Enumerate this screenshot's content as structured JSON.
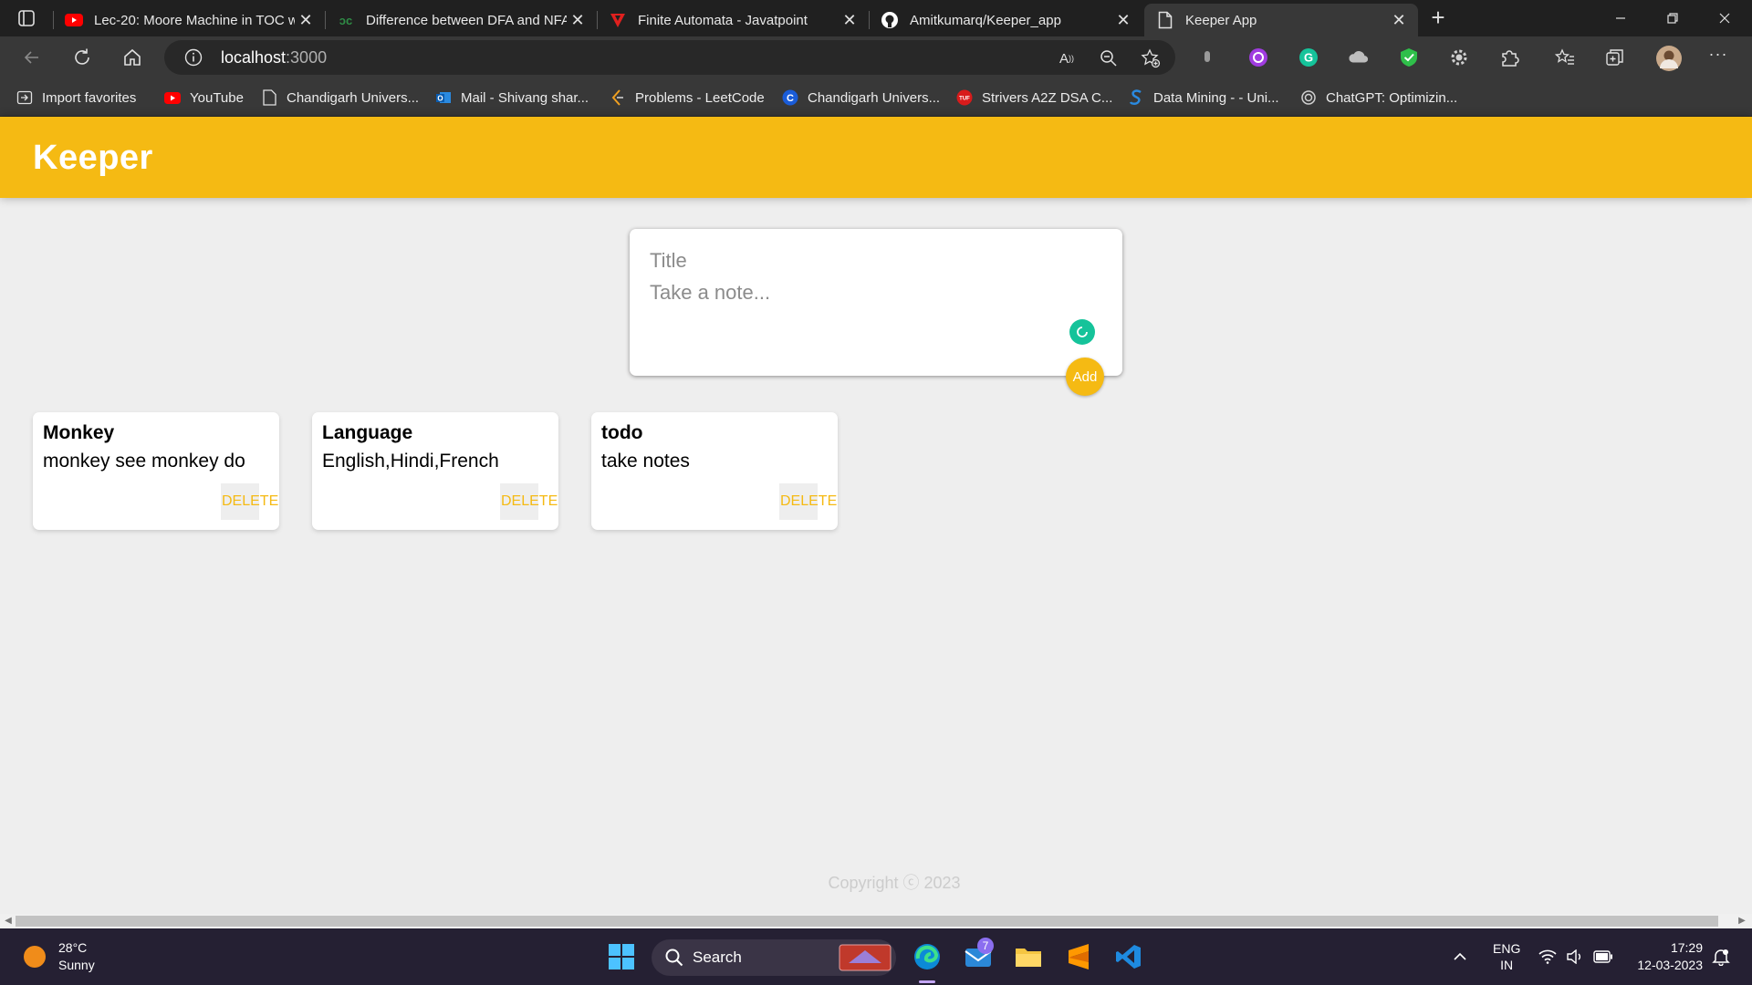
{
  "browser": {
    "tabs": [
      {
        "title": "Lec-20: Moore Machine in TOC w",
        "favicon": "youtube-icon",
        "active": false
      },
      {
        "title": "Difference between DFA and NFA",
        "favicon": "geeksforgeeks-icon",
        "active": false
      },
      {
        "title": "Finite Automata - Javatpoint",
        "favicon": "javatpoint-icon",
        "active": false
      },
      {
        "title": "Amitkumarq/Keeper_app",
        "favicon": "github-icon",
        "active": false
      },
      {
        "title": "Keeper App",
        "favicon": "page-icon",
        "active": true
      }
    ],
    "url_host": "localhost",
    "url_port": ":3000",
    "bookmarks": [
      {
        "label": "Import favorites",
        "icon": "import-icon"
      },
      {
        "label": "YouTube",
        "icon": "youtube-icon"
      },
      {
        "label": "Chandigarh Univers...",
        "icon": "page-icon"
      },
      {
        "label": "Mail - Shivang shar...",
        "icon": "outlook-icon"
      },
      {
        "label": "Problems - LeetCode",
        "icon": "leetcode-icon"
      },
      {
        "label": "Chandigarh Univers...",
        "icon": "cu-icon"
      },
      {
        "label": "Strivers A2Z DSA C...",
        "icon": "tuf-icon"
      },
      {
        "label": "Data Mining - - Uni...",
        "icon": "studocu-icon"
      },
      {
        "label": "ChatGPT: Optimizin...",
        "icon": "chatgpt-icon"
      }
    ]
  },
  "app": {
    "title": "Keeper",
    "create": {
      "title_placeholder": "Title",
      "content_placeholder": "Take a note...",
      "add_label": "Add"
    },
    "notes": [
      {
        "title": "Monkey",
        "content": "monkey see monkey do",
        "delete_label": "DELETE"
      },
      {
        "title": "Language",
        "content": "English,Hindi,French",
        "delete_label": "DELETE"
      },
      {
        "title": "todo",
        "content": "take notes",
        "delete_label": "DELETE"
      }
    ],
    "footer": "Copyright ⓒ 2023"
  },
  "taskbar": {
    "weather_temp": "28°C",
    "weather_desc": "Sunny",
    "search_label": "Search",
    "mail_badge": "7",
    "lang_line1": "ENG",
    "lang_line2": "IN",
    "time": "17:29",
    "date": "12-03-2023"
  },
  "colors": {
    "accent": "#f5ba13",
    "page_bg": "#eeeeee",
    "grammarly": "#15c39a"
  }
}
